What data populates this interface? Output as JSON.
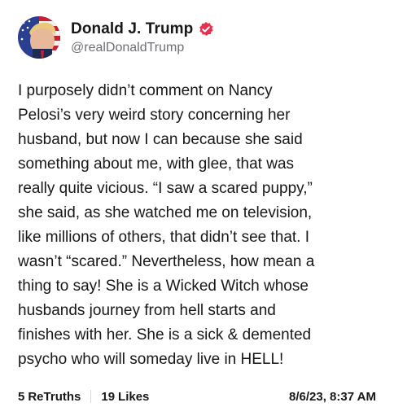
{
  "author": {
    "display_name": "Donald J. Trump",
    "handle": "@realDonaldTrump",
    "verified_icon": "verified-badge-icon",
    "verified_color": "#e8304f",
    "avatar_icon": "profile-avatar"
  },
  "post": {
    "text": "I purposely didn’t comment on Nancy\nPelosi’s very weird story concerning her\nhusband, but now I can because she said\nsomething about me, with glee, that was\nreally quite vicious. “I saw a scared puppy,”\nshe said, as she watched me on television,\nlike millions of others, that didn’t see that. I\nwasn’t “scared.” Nevertheless, how mean a\nthing to say! She is a Wicked Witch whose\nhusbands journey from hell starts and\nfinishes with her. She is a sick & demented\npsycho who will someday live in HELL!"
  },
  "stats": {
    "retruths_count": "5",
    "retruths_label": "ReTruths",
    "likes_count": "19",
    "likes_label": "Likes"
  },
  "timestamp": "8/6/23, 8:37 AM"
}
